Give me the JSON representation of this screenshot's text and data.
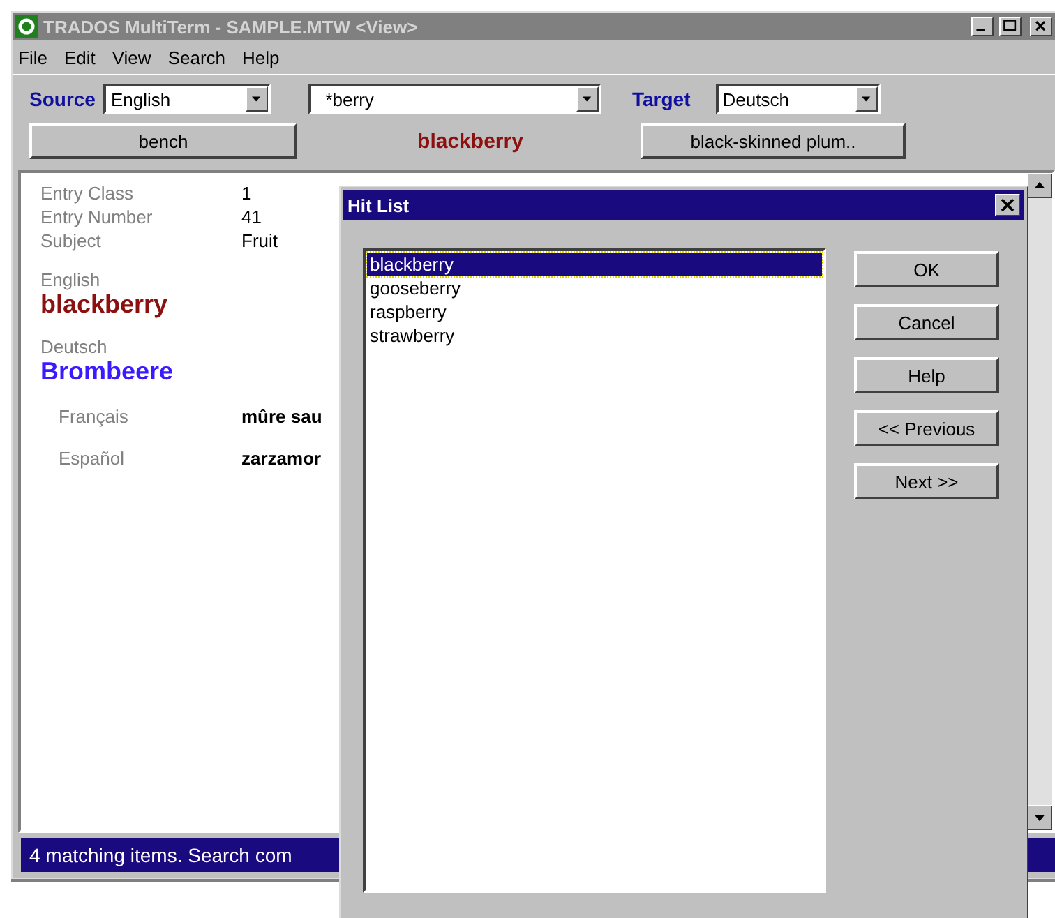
{
  "window": {
    "title": "TRADOS MultiTerm - SAMPLE.MTW <View>"
  },
  "menu": [
    "File",
    "Edit",
    "View",
    "Search",
    "Help"
  ],
  "toolbar": {
    "source_label": "Source",
    "source": "English",
    "search": "*berry",
    "target_label": "Target",
    "target": "Deutsch",
    "previous_button": "bench",
    "current": "blackberry",
    "next_button": "black-skinned plum.."
  },
  "entry": {
    "fields": [
      {
        "label": "Entry Class",
        "value": "1"
      },
      {
        "label": "Entry Number",
        "value": "41"
      },
      {
        "label": "Subject",
        "value": "Fruit"
      }
    ],
    "terms": [
      {
        "language": "English",
        "term": "blackberry",
        "kind": "source"
      },
      {
        "language": "Deutsch",
        "term": "Brombeere",
        "kind": "target"
      }
    ],
    "other_terms": [
      {
        "language": "Français",
        "term": "mûre sau"
      },
      {
        "language": "Español",
        "term": "zarzamor"
      }
    ]
  },
  "status_bar": "4 matching items. Search com",
  "dialog": {
    "title": "Hit List",
    "items": [
      {
        "label": "blackberry",
        "selected": true
      },
      {
        "label": "gooseberry",
        "selected": false
      },
      {
        "label": "raspberry",
        "selected": false
      },
      {
        "label": "strawberry",
        "selected": false
      }
    ],
    "buttons": [
      "OK",
      "Cancel",
      "Help",
      "<< Previous",
      "Next >>"
    ]
  }
}
